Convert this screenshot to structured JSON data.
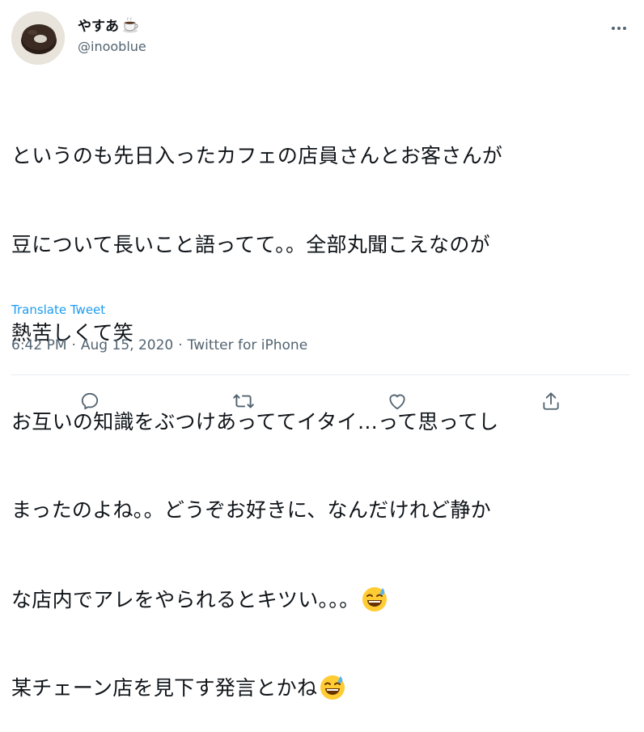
{
  "user": {
    "name": "やすあ",
    "name_emoji": "coffee-cup-emoji",
    "handle": "@inooblue"
  },
  "tweet": {
    "lines": [
      "というのも先日入ったカフェの店員さんとお客さんが",
      "豆について長いこと語ってて。。全部丸聞こえなのが",
      "熱苦しくて笑",
      "お互いの知識をぶつけあっててイタイ…って思ってし",
      "まったのよね。。どうぞお好きに、なんだけれど静か",
      "な店内でアレをやられるとキツい。。。",
      "某チェーン店を見下す発言とかね"
    ],
    "emoji": "grinning-face-with-sweat-emoji"
  },
  "translate_label": "Translate Tweet",
  "meta": {
    "time": "6:42 PM",
    "sep1": "·",
    "date": "Aug 15, 2020",
    "sep2": "·",
    "source": "Twitter for iPhone"
  },
  "icons": {
    "reply": "reply-icon",
    "retweet": "retweet-icon",
    "like": "like-icon",
    "share": "share-icon",
    "more": "more-icon"
  },
  "colors": {
    "text": "#0f1419",
    "secondary": "#536471",
    "link": "#1d9bf0",
    "divider": "#e6ecf0"
  }
}
